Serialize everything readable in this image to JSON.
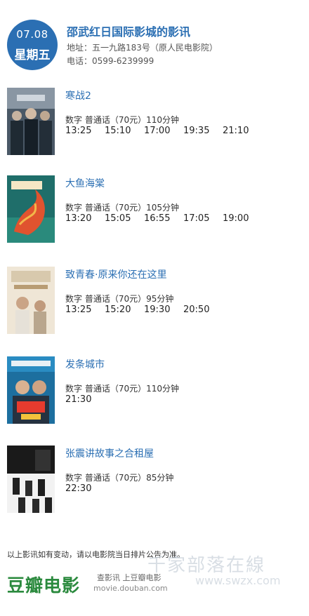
{
  "header": {
    "date": "07.08",
    "weekday": "星期五",
    "cinema_name": "邵武红日国际影城的影讯",
    "address": "地址：五一九路183号（原人民电影院）",
    "phone": "电话：0599-6239999"
  },
  "movies": [
    {
      "title": "寒战2",
      "info": "数字  普通话（70元）110分钟",
      "times": [
        "13:25",
        "15:10",
        "17:00",
        "19:35",
        "21:10"
      ],
      "poster_icon": "movie-poster-cold-war-2"
    },
    {
      "title": "大鱼海棠",
      "info": "数字  普通话（70元）105分钟",
      "times": [
        "13:20",
        "15:05",
        "16:55",
        "17:05",
        "19:00"
      ],
      "poster_icon": "movie-poster-big-fish-begonia"
    },
    {
      "title": "致青春·原来你还在这里",
      "info": "数字  普通话（70元）95分钟",
      "times": [
        "13:25",
        "15:20",
        "19:30",
        "20:50"
      ],
      "poster_icon": "movie-poster-so-young-2"
    },
    {
      "title": "发条城市",
      "info": "数字  普通话（70元）110分钟",
      "times": [
        "21:30"
      ],
      "poster_icon": "movie-poster-clockwork-city"
    },
    {
      "title": "张震讲故事之合租屋",
      "info": "数字  普通话（70元）85分钟",
      "times": [
        "22:30"
      ],
      "poster_icon": "movie-poster-shared-house"
    }
  ],
  "footer": {
    "note": "以上影讯如有变动，请以电影院当日排片公告为准。",
    "logo": "豆瓣电影",
    "tagline": "查影讯  上豆瓣电影",
    "url": "movie.douban.com",
    "watermark": "千家部落在線",
    "watermark_url": "www.swzx.com"
  },
  "colors": {
    "accent": "#2b6fb3",
    "logo_green": "#2b8a3e"
  }
}
